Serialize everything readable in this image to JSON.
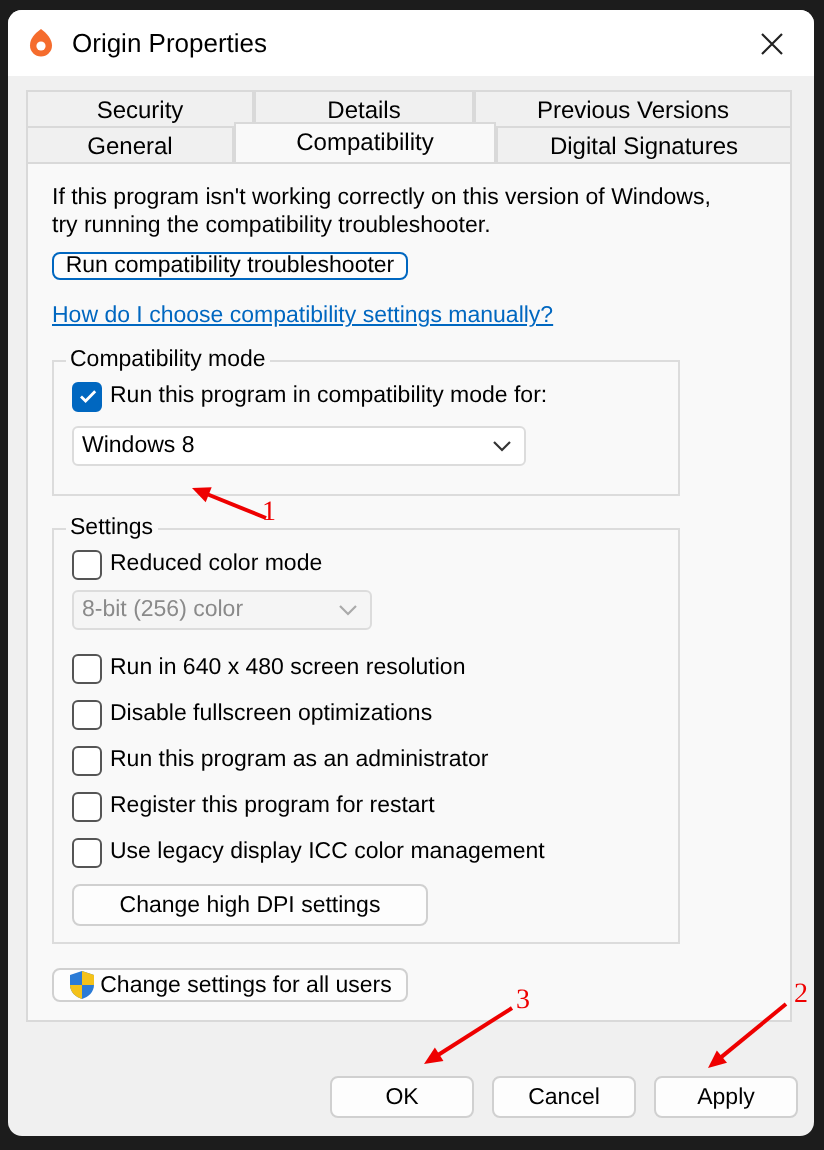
{
  "window": {
    "title": "Origin Properties"
  },
  "tabs": [
    [
      {
        "label": "Security",
        "selected": false
      },
      {
        "label": "Details",
        "selected": false
      },
      {
        "label": "Previous Versions",
        "selected": false
      }
    ],
    [
      {
        "label": "General",
        "selected": false
      },
      {
        "label": "Compatibility",
        "selected": true
      },
      {
        "label": "Digital Signatures",
        "selected": false
      }
    ]
  ],
  "intro": "If this program isn't working correctly on this version of Windows, try running the compatibility troubleshooter.",
  "troubleshoot_button": "Run compatibility troubleshooter",
  "help_link": "How do I choose compatibility settings manually?",
  "groups": [
    {
      "title": "Compatibility mode",
      "items": [
        {
          "kind": "checkbox",
          "label": "Run this program in compatibility mode for:",
          "checked": true
        },
        {
          "kind": "select",
          "value": "Windows 8",
          "disabled": false
        }
      ]
    },
    {
      "title": "Settings",
      "items": [
        {
          "kind": "checkbox",
          "label": "Reduced color mode",
          "checked": false
        },
        {
          "kind": "select",
          "value": "8-bit (256) color",
          "disabled": true
        },
        {
          "kind": "checkbox",
          "label": "Run in 640 x 480 screen resolution",
          "checked": false
        },
        {
          "kind": "checkbox",
          "label": "Disable fullscreen optimizations",
          "checked": false
        },
        {
          "kind": "checkbox",
          "label": "Run this program as an administrator",
          "checked": false
        },
        {
          "kind": "checkbox",
          "label": "Register this program for restart",
          "checked": false
        },
        {
          "kind": "checkbox",
          "label": "Use legacy display ICC color management",
          "checked": false
        },
        {
          "kind": "button",
          "label": "Change high DPI settings"
        }
      ]
    }
  ],
  "all_users_button": "Change settings for all users",
  "buttons": [
    "OK",
    "Cancel",
    "Apply"
  ],
  "annotations": [
    {
      "label": "1"
    },
    {
      "label": "3"
    },
    {
      "label": "2"
    }
  ]
}
